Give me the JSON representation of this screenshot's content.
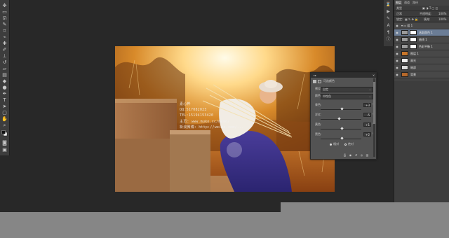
{
  "watermark": {
    "line1": "素心桦",
    "line2": "QQ:517082023",
    "line3": "TEL:15194153420",
    "line4": "主页: www.muko.cc/memo/",
    "line5": "新浪微博: http://weibo.com/..."
  },
  "dialog": {
    "title": "可选颜色",
    "preset_label": "预设:",
    "preset_value": "自定",
    "colors_label": "颜色:",
    "colors_value": "中性色",
    "sliders": [
      {
        "label": "青色:",
        "value": "+3",
        "pct": "%",
        "level": 0.52
      },
      {
        "label": "洋红:",
        "value": "-5",
        "pct": "%",
        "level": 0.45
      },
      {
        "label": "黄色:",
        "value": "+1",
        "pct": "%",
        "level": 0.51
      },
      {
        "label": "黑色:",
        "value": "+2",
        "pct": "%",
        "level": 0.52
      }
    ],
    "method_relative": "相对",
    "method_absolute": "绝对"
  },
  "layers": {
    "tabs": [
      "图层",
      "通道",
      "路径"
    ],
    "kind_label": "类型",
    "blend_mode": "正常",
    "opacity_label": "不透明度:",
    "opacity_value": "100%",
    "lock_label": "锁定:",
    "fill_label": "填充:",
    "fill_value": "100%",
    "group_name": "组 1",
    "rows": [
      {
        "name": "选取颜色 1",
        "selected": true
      },
      {
        "name": "曲线 1",
        "selected": false
      },
      {
        "name": "色彩平衡 1",
        "selected": false
      },
      {
        "name": "图层 1",
        "selected": false
      },
      {
        "name": "高光",
        "selected": false
      },
      {
        "name": "暗部",
        "selected": false
      },
      {
        "name": "背景",
        "selected": false
      }
    ]
  },
  "colors": {
    "app_bg": "#282828",
    "panel": "#434343",
    "selection": "#6b7d96",
    "bottom_band": "#868686"
  }
}
